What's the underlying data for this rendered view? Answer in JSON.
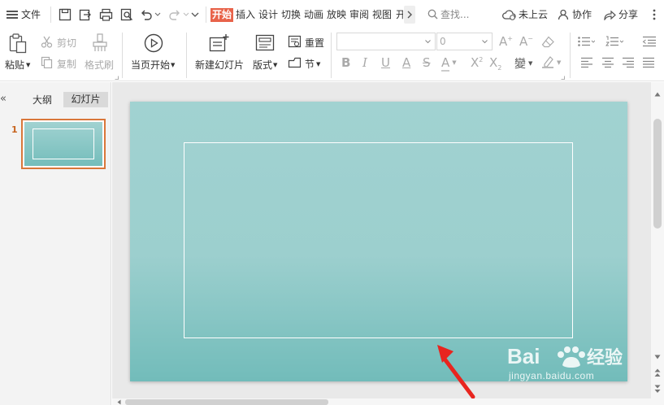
{
  "menubar": {
    "file_label": "文件",
    "tabs": [
      {
        "label": "开始",
        "active": true
      },
      {
        "label": "插入",
        "active": false
      },
      {
        "label": "设计",
        "active": false
      },
      {
        "label": "切换",
        "active": false
      },
      {
        "label": "动画",
        "active": false
      },
      {
        "label": "放映",
        "active": false
      },
      {
        "label": "审阅",
        "active": false
      },
      {
        "label": "视图",
        "active": false
      },
      {
        "label": "开",
        "active": false
      }
    ],
    "search_label": "查找...",
    "cloud_label": "未上云",
    "collab_label": "协作",
    "share_label": "分享"
  },
  "ribbon": {
    "paste_label": "粘贴",
    "cut_label": "剪切",
    "copy_label": "复制",
    "format_painter_label": "格式刷",
    "play_label": "当页开始",
    "new_slide_label": "新建幻灯片",
    "layout_label": "版式",
    "reset_label": "重置",
    "section_label": "节",
    "font_size_value": "0"
  },
  "side_panel": {
    "outline_tab": "大纲",
    "slides_tab": "幻灯片",
    "slide_number": "1"
  },
  "colors": {
    "accent": "#e8634a",
    "slide_top": "#a1d2d1",
    "slide_bottom": "#72bcba",
    "thumbnail_border": "#d9773a",
    "arrow": "#e8251f"
  },
  "watermark": {
    "logo_text": "Baidu经验",
    "url": "jingyan.baidu.com"
  }
}
